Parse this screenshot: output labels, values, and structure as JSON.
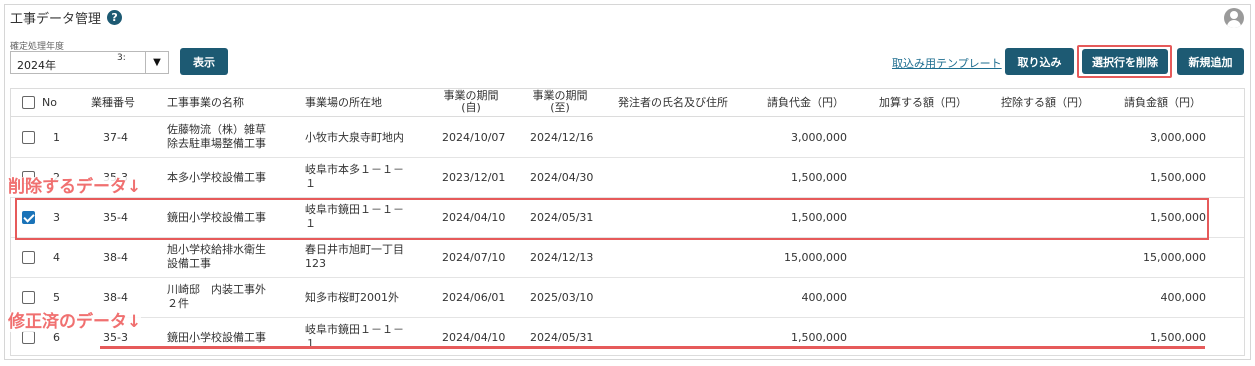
{
  "header": {
    "title": "工事データ管理",
    "help_icon": "?"
  },
  "filter": {
    "year_label": "確定処理年度",
    "year_value": "2024年",
    "year_small": "3:",
    "show_label": "表示"
  },
  "toolbar": {
    "template_link": "取込み用テンプレート",
    "import_label": "取り込み",
    "delete_label": "選択行を削除",
    "new_label": "新規追加"
  },
  "table": {
    "headers": {
      "no": "No",
      "category": "業種番号",
      "name": "工事事業の名称",
      "location": "事業場の所在地",
      "period_from_1": "事業の期間",
      "period_from_2": "(自)",
      "period_to_1": "事業の期間",
      "period_to_2": "(至)",
      "client": "発注者の氏名及び住所",
      "contract": "請負代金（円）",
      "add": "加算する額（円）",
      "deduct": "控除する額（円）",
      "total": "請負金額（円）"
    },
    "rows": [
      {
        "no": "1",
        "category": "37-4",
        "name1": "佐藤物流（株）雑草",
        "name2": "除去駐車場整備工事",
        "loc1": "小牧市大泉寺町地内",
        "loc2": "",
        "from": "2024/10/07",
        "to": "2024/12/16",
        "contract": "3,000,000",
        "total": "3,000,000",
        "checked": false
      },
      {
        "no": "2",
        "category": "35-3",
        "name1": "本多小学校設備工事",
        "name2": "",
        "loc1": "岐阜市本多１－１－",
        "loc2": "１",
        "from": "2023/12/01",
        "to": "2024/04/30",
        "contract": "1,500,000",
        "total": "1,500,000",
        "checked": false
      },
      {
        "no": "3",
        "category": "35-4",
        "name1": "鏡田小学校設備工事",
        "name2": "",
        "loc1": "岐阜市鏡田１－１－",
        "loc2": "１",
        "from": "2024/04/10",
        "to": "2024/05/31",
        "contract": "1,500,000",
        "total": "1,500,000",
        "checked": true
      },
      {
        "no": "4",
        "category": "38-4",
        "name1": "旭小学校給排水衛生",
        "name2": "設備工事",
        "loc1": "春日井市旭町一丁目",
        "loc2": "123",
        "from": "2024/07/10",
        "to": "2024/12/13",
        "contract": "15,000,000",
        "total": "15,000,000",
        "checked": false
      },
      {
        "no": "5",
        "category": "38-4",
        "name1": "川崎邸　内装工事外",
        "name2": "２件",
        "loc1": "知多市桜町2001外",
        "loc2": "",
        "from": "2024/06/01",
        "to": "2025/03/10",
        "contract": "400,000",
        "total": "400,000",
        "checked": false
      },
      {
        "no": "6",
        "category": "35-3",
        "name1": "鏡田小学校設備工事",
        "name2": "",
        "loc1": "岐阜市鏡田１－１－",
        "loc2": "１",
        "from": "2024/04/10",
        "to": "2024/05/31",
        "contract": "1,500,000",
        "total": "1,500,000",
        "checked": false
      }
    ]
  },
  "annotations": {
    "delete_note": "削除するデータ↓",
    "fixed_note": "修正済のデータ↓"
  },
  "colors": {
    "accent": "#1d5a73",
    "highlight": "#e65a5a",
    "checkbox": "#1a73b8"
  }
}
